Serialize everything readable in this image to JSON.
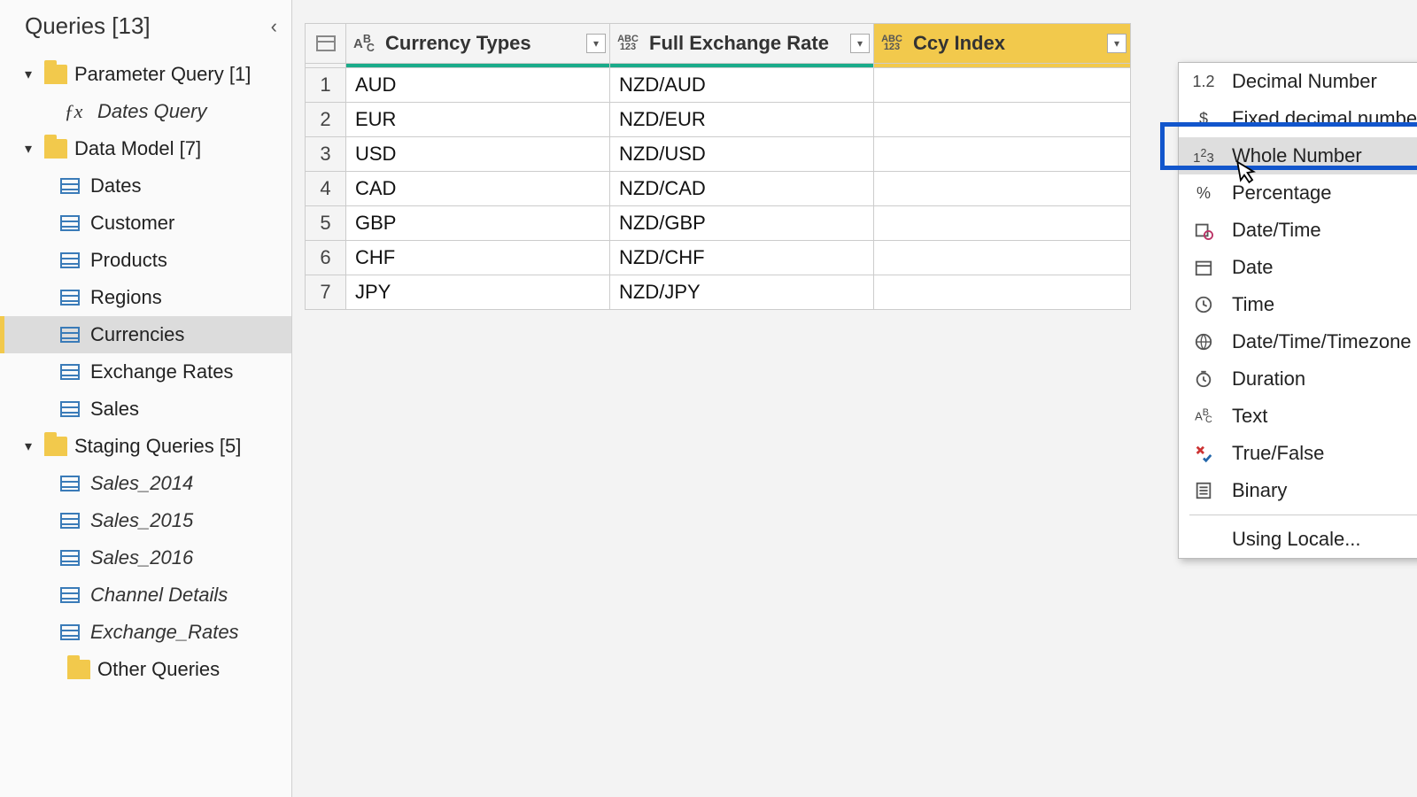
{
  "sidebar": {
    "title": "Queries [13]",
    "groups": [
      {
        "label": "Parameter Query [1]",
        "items": [
          {
            "label": "Dates Query",
            "icon": "fx",
            "italic": true
          }
        ]
      },
      {
        "label": "Data Model [7]",
        "items": [
          {
            "label": "Dates",
            "icon": "table"
          },
          {
            "label": "Customer",
            "icon": "table"
          },
          {
            "label": "Products",
            "icon": "table"
          },
          {
            "label": "Regions",
            "icon": "table"
          },
          {
            "label": "Currencies",
            "icon": "table",
            "selected": true
          },
          {
            "label": "Exchange Rates",
            "icon": "table"
          },
          {
            "label": "Sales",
            "icon": "table"
          }
        ]
      },
      {
        "label": "Staging Queries [5]",
        "items": [
          {
            "label": "Sales_2014",
            "icon": "table",
            "italic": true
          },
          {
            "label": "Sales_2015",
            "icon": "table",
            "italic": true
          },
          {
            "label": "Sales_2016",
            "icon": "table",
            "italic": true
          },
          {
            "label": "Channel Details",
            "icon": "table",
            "italic": true
          },
          {
            "label": "Exchange_Rates",
            "icon": "table",
            "italic": true
          }
        ]
      },
      {
        "label": "Other Queries",
        "items": [],
        "leafless": true
      }
    ]
  },
  "columns": [
    {
      "name": "Currency Types",
      "type": "ABC"
    },
    {
      "name": "Full Exchange Rate",
      "type": "ABC123"
    },
    {
      "name": "Ccy Index",
      "type": "ABC123",
      "selected": true
    }
  ],
  "rows": [
    {
      "n": "1",
      "c0": "AUD",
      "c1": "NZD/AUD"
    },
    {
      "n": "2",
      "c0": "EUR",
      "c1": "NZD/EUR"
    },
    {
      "n": "3",
      "c0": "USD",
      "c1": "NZD/USD"
    },
    {
      "n": "4",
      "c0": "CAD",
      "c1": "NZD/CAD"
    },
    {
      "n": "5",
      "c0": "GBP",
      "c1": "NZD/GBP"
    },
    {
      "n": "6",
      "c0": "CHF",
      "c1": "NZD/CHF"
    },
    {
      "n": "7",
      "c0": "JPY",
      "c1": "NZD/JPY"
    }
  ],
  "type_menu": [
    {
      "label": "Decimal Number",
      "icon": "1.2"
    },
    {
      "label": "Fixed decimal number",
      "icon": "$"
    },
    {
      "label": "Whole Number",
      "icon": "1²3",
      "highlight": true
    },
    {
      "label": "Percentage",
      "icon": "%"
    },
    {
      "label": "Date/Time",
      "icon": "datetime"
    },
    {
      "label": "Date",
      "icon": "date"
    },
    {
      "label": "Time",
      "icon": "time"
    },
    {
      "label": "Date/Time/Timezone",
      "icon": "tz"
    },
    {
      "label": "Duration",
      "icon": "dur"
    },
    {
      "label": "Text",
      "icon": "ABC"
    },
    {
      "label": "True/False",
      "icon": "tf"
    },
    {
      "label": "Binary",
      "icon": "bin"
    }
  ],
  "type_menu_footer": "Using Locale..."
}
